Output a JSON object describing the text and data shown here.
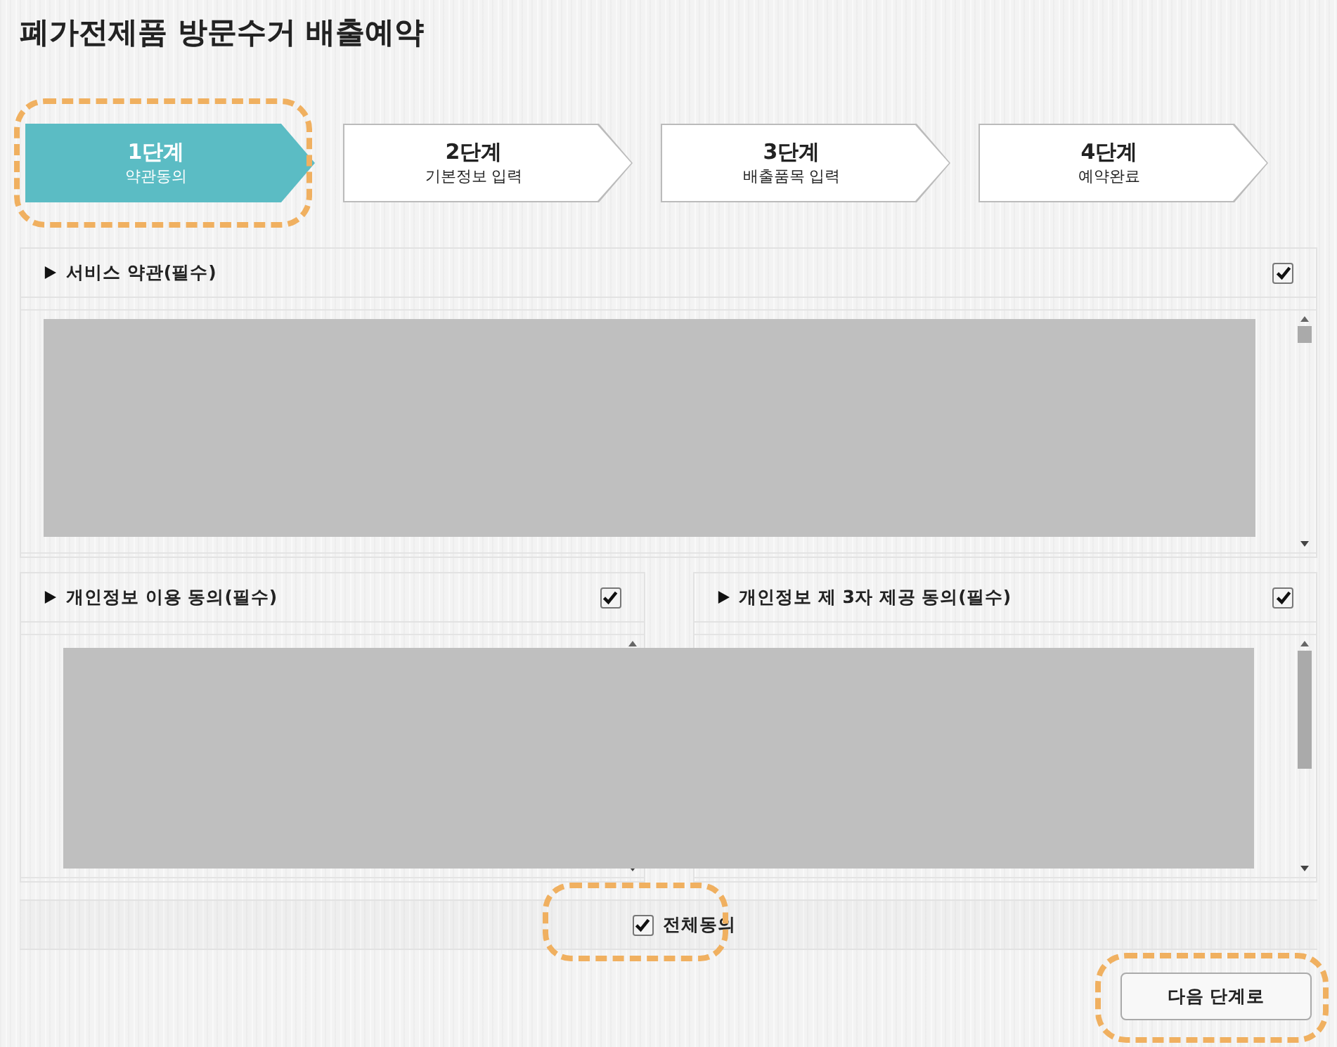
{
  "window": {
    "title": "폐가전제품 방문수거 배출예약"
  },
  "steps": [
    {
      "number": "1단계",
      "label": "약관동의",
      "selected": true,
      "highlighted": true
    },
    {
      "number": "2단계",
      "label": "기본정보 입력",
      "selected": false,
      "highlighted": false
    },
    {
      "number": "3단계",
      "label": "배출품목 입력",
      "selected": false,
      "highlighted": false
    },
    {
      "number": "4단계",
      "label": "예약완료",
      "selected": false,
      "highlighted": false
    }
  ],
  "terms": {
    "title": "서비스 약관(필수)",
    "checked": true,
    "redacted": true
  },
  "agreements": {
    "redacted": true,
    "items": [
      {
        "title": "개인정보 이용 동의(필수)",
        "checked": true
      },
      {
        "title": "개인정보 제 3자 제공 동의(필수)",
        "checked": true
      }
    ]
  },
  "agree_all": {
    "label": "전체동의",
    "checked": true,
    "highlighted": true
  },
  "next_button": {
    "label": "다음 단계로",
    "highlighted": true
  }
}
